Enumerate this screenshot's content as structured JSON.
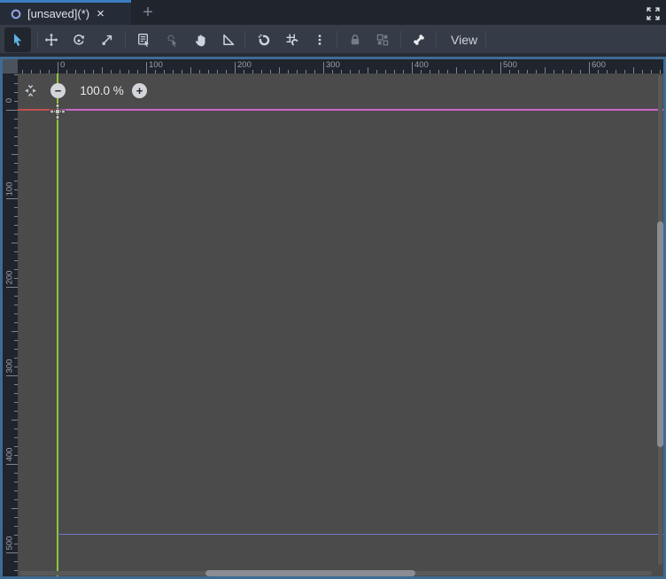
{
  "tab_bar": {
    "active_tab_label": "[unsaved](*)",
    "close_icon": "×",
    "new_tab_icon": "+"
  },
  "toolbar": {
    "view_label": "View",
    "tools": [
      "select",
      "move",
      "rotate",
      "scale",
      "list-select",
      "click-select",
      "pan",
      "ruler",
      "smart-snap",
      "grid-snap",
      "snap-options",
      "lock",
      "group",
      "skeleton-options",
      "view-menu"
    ],
    "active_tool": "select",
    "disabled_tools": [
      "click-select",
      "lock",
      "group"
    ]
  },
  "zoom_controls": {
    "zoom_out_icon": "−",
    "zoom_percent": "100.0 %",
    "zoom_in_icon": "+"
  },
  "rulers": {
    "horizontal": {
      "origin": 45,
      "step": 100,
      "labels": [
        "0",
        "100",
        "200",
        "300",
        "400",
        "500",
        "600"
      ]
    },
    "vertical": {
      "origin": 41,
      "step": 100,
      "labels": [
        "0",
        "100",
        "200",
        "300",
        "400",
        "500"
      ]
    }
  },
  "colors": {
    "accent_blue": "#3c7dbf",
    "active_tool_blue": "#5fb2e5",
    "axis_x_red": "#c25050",
    "axis_y_green": "#8dc63f",
    "viewport_border_magenta": "#cd66cd",
    "guide_blue": "#7477cd",
    "focus_border_blue": "#3f6b94"
  }
}
